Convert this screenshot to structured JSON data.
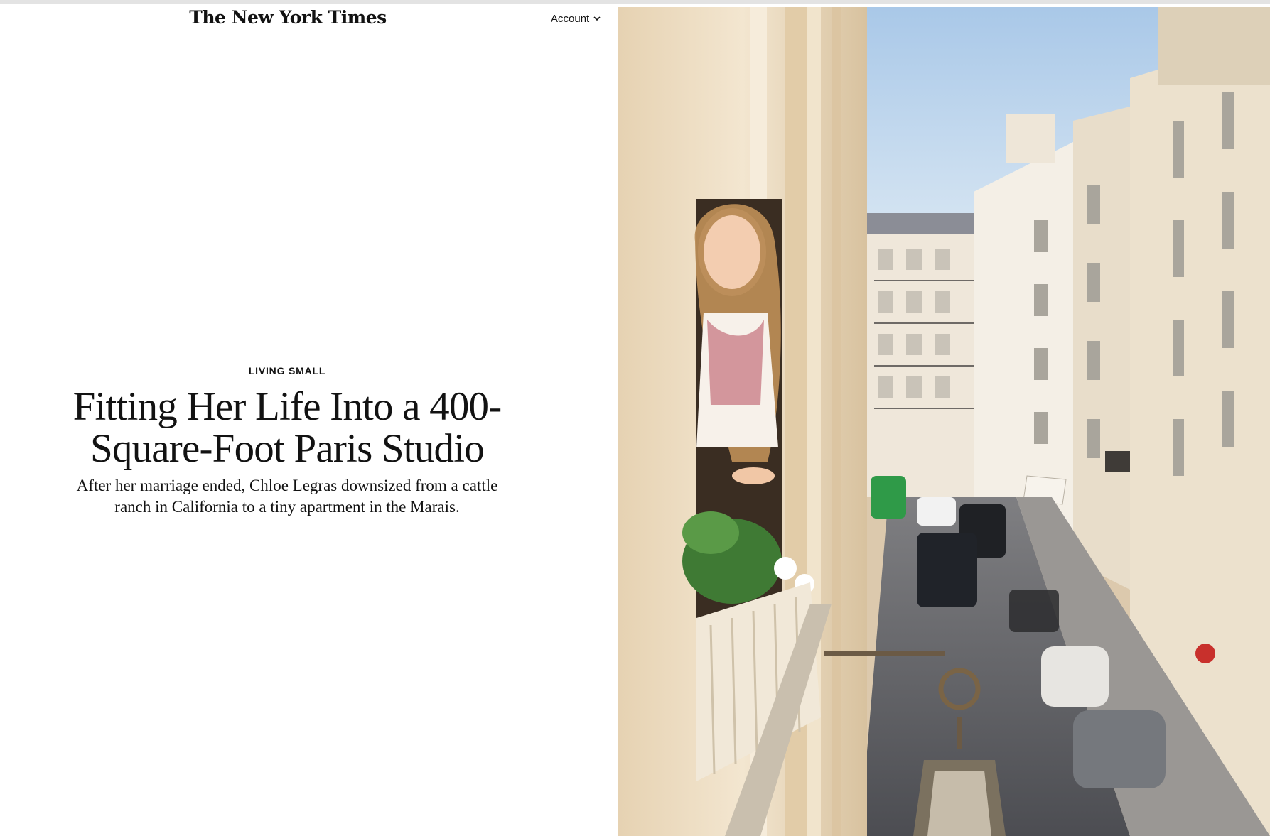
{
  "header": {
    "logo_text": "The New York Times",
    "account_label": "Account",
    "account_icon": "chevron-down-icon"
  },
  "article": {
    "kicker": "LIVING SMALL",
    "headline": "Fitting Her Life Into a 400-Square-Foot Paris Studio",
    "dek": "After her marriage ended, Chloe Legras downsized from a cattle ranch in California to a tiny apartment in the Marais."
  },
  "photo": {
    "subject": "woman leaning out of a window above a Paris street"
  },
  "colors": {
    "text": "#121212",
    "background": "#ffffff",
    "sky": "#b8d3ec",
    "facade": "#efe3cf"
  }
}
